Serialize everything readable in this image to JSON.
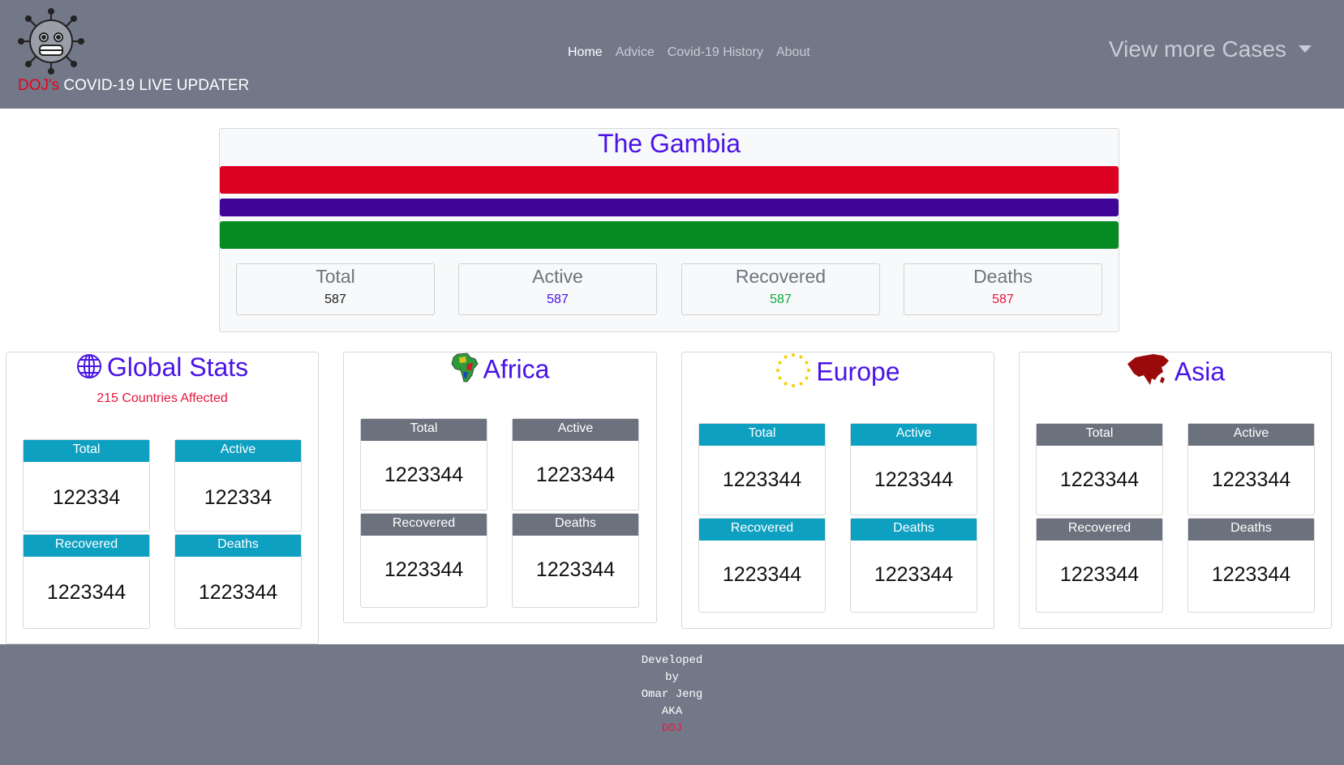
{
  "navbar": {
    "brand_prefix": "DOJ's",
    "brand_suffix": " COVID-19 LIVE UPDATER",
    "links": [
      "Home",
      "Advice",
      "Covid-19 History",
      "About"
    ],
    "more_cases": "View more Cases"
  },
  "country": {
    "name": "The Gambia",
    "flag_colors": [
      "#dc0021",
      "#3e0596",
      "#068a23"
    ],
    "stats": [
      {
        "label": "Total",
        "value": "587",
        "color": "#222222"
      },
      {
        "label": "Active",
        "value": "587",
        "color": "#4a14e6"
      },
      {
        "label": "Recovered",
        "value": "587",
        "color": "#0aaa3a"
      },
      {
        "label": "Deaths",
        "value": "587",
        "color": "#e6173d"
      }
    ]
  },
  "regions": {
    "global": {
      "title": "Global Stats",
      "subtitle": "215 Countries Affected",
      "icon": "globe-icon",
      "boxes": [
        {
          "label": "Total",
          "value": "122334"
        },
        {
          "label": "Active",
          "value": "122334"
        },
        {
          "label": "Recovered",
          "value": "1223344"
        },
        {
          "label": "Deaths",
          "value": "1223344"
        }
      ]
    },
    "africa": {
      "title": "Africa",
      "icon": "africa-map-icon",
      "boxes": [
        {
          "label": "Total",
          "value": "1223344"
        },
        {
          "label": "Active",
          "value": "1223344"
        },
        {
          "label": "Recovered",
          "value": "1223344"
        },
        {
          "label": "Deaths",
          "value": "1223344"
        }
      ]
    },
    "europe": {
      "title": "Europe",
      "icon": "eu-stars-icon",
      "boxes": [
        {
          "label": "Total",
          "value": "1223344"
        },
        {
          "label": "Active",
          "value": "1223344"
        },
        {
          "label": "Recovered",
          "value": "1223344"
        },
        {
          "label": "Deaths",
          "value": "1223344"
        }
      ]
    },
    "asia": {
      "title": "Asia",
      "icon": "asia-map-icon",
      "boxes": [
        {
          "label": "Total",
          "value": "1223344"
        },
        {
          "label": "Active",
          "value": "1223344"
        },
        {
          "label": "Recovered",
          "value": "1223344"
        },
        {
          "label": "Deaths",
          "value": "1223344"
        }
      ]
    }
  },
  "footer": {
    "lines": [
      "Developed",
      "by",
      "Omar Jeng",
      "AKA"
    ],
    "signature": "DOJ"
  },
  "colors": {
    "accent": "#4a14e6",
    "teal": "#0ea0c1",
    "gray_header": "#6c717e",
    "navbar_bg": "#737889"
  }
}
